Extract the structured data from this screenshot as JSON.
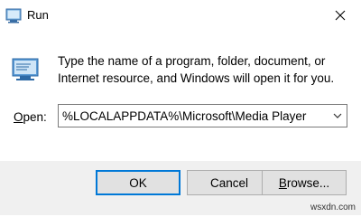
{
  "window": {
    "title": "Run",
    "close_glyph": "✕"
  },
  "prompt": {
    "description": "Type the name of a program, folder, document, or Internet resource, and Windows will open it for you."
  },
  "open": {
    "label_prefix": "",
    "label_underlined": "O",
    "label_rest": "pen:",
    "value": "%LOCALAPPDATA%\\Microsoft\\Media Player"
  },
  "buttons": {
    "ok": "OK",
    "cancel": "Cancel",
    "browse_underlined": "B",
    "browse_rest": "rowse..."
  },
  "watermark": "wsxdn.com",
  "colors": {
    "accent": "#0078d7",
    "footer": "#f0f0f0",
    "button_face": "#e1e1e1"
  },
  "icons": [
    "run-app-icon",
    "close-icon",
    "run-large-icon",
    "chevron-down-icon"
  ]
}
